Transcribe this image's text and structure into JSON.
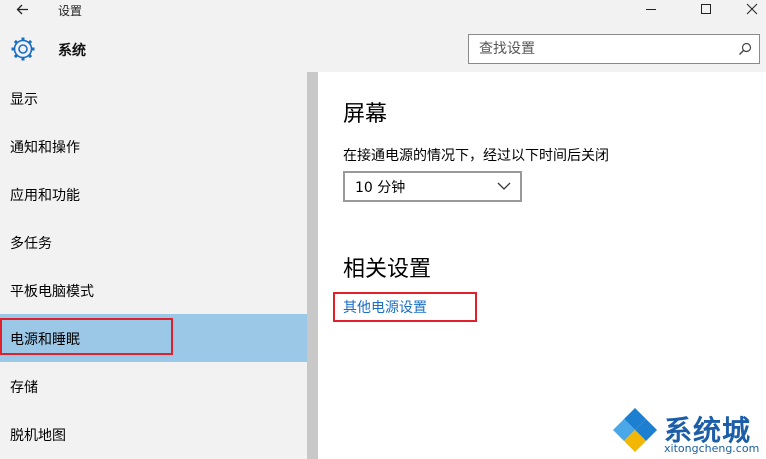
{
  "window": {
    "title": "设置"
  },
  "header": {
    "title": "系统",
    "search_placeholder": "查找设置"
  },
  "sidebar": {
    "items": [
      {
        "label": "显示"
      },
      {
        "label": "通知和操作"
      },
      {
        "label": "应用和功能"
      },
      {
        "label": "多任务"
      },
      {
        "label": "平板电脑模式"
      },
      {
        "label": "电源和睡眠",
        "selected": true
      },
      {
        "label": "存储"
      },
      {
        "label": "脱机地图"
      }
    ]
  },
  "content": {
    "screen_heading": "屏幕",
    "screen_desc": "在接通电源的情况下，经过以下时间后关闭",
    "screen_timeout": "10 分钟",
    "related_heading": "相关设置",
    "related_link": "其他电源设置"
  },
  "watermark": {
    "brand": "系统城",
    "site": "xitongcheng.com"
  },
  "colors": {
    "accent": "#9cc8e8",
    "link": "#1a6ec4",
    "highlight": "#e0202a",
    "gear": "#1a6ec4"
  },
  "icons": [
    "back-arrow-icon",
    "gear-icon",
    "search-icon",
    "chevron-down-icon",
    "minimize-icon",
    "maximize-icon",
    "close-icon"
  ]
}
